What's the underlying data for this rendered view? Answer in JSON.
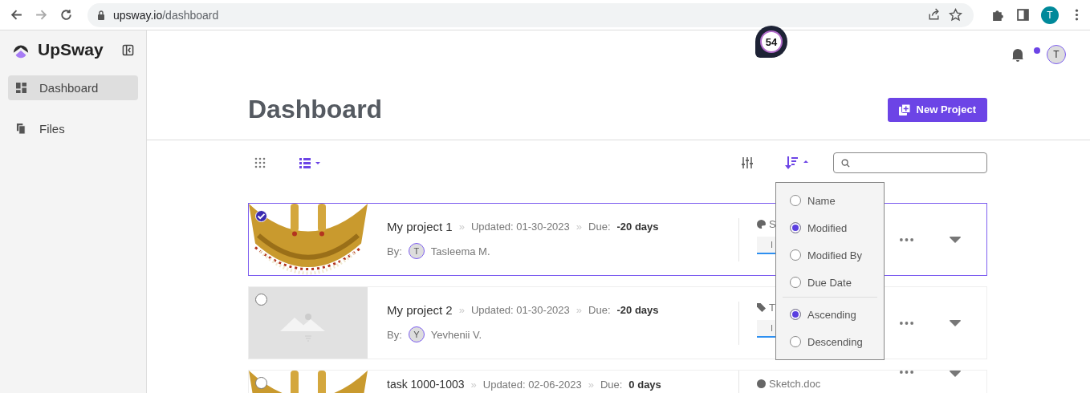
{
  "browser": {
    "url_host": "upsway.io",
    "url_path": "/dashboard",
    "profile": "T"
  },
  "sidebar": {
    "logo": "UpSway",
    "items": [
      {
        "label": "Dashboard",
        "kind": "dashboard",
        "selected": true
      },
      {
        "label": "Files",
        "kind": "files",
        "selected": false
      }
    ]
  },
  "header": {
    "score": "54",
    "notification": true,
    "avatar": "T"
  },
  "page": {
    "title": "Dashboard",
    "new_button": "New Project"
  },
  "view_options": [
    {
      "kind": "grid",
      "selected": false
    },
    {
      "kind": "list",
      "selected": true
    }
  ],
  "sort_menu": {
    "fields": [
      {
        "label": "Name",
        "selected": false
      },
      {
        "label": "Modified",
        "selected": true
      },
      {
        "label": "Modified By",
        "selected": false
      },
      {
        "label": "Due Date",
        "selected": false
      }
    ],
    "orders": [
      {
        "label": "Ascending",
        "selected": true
      },
      {
        "label": "Descending",
        "selected": false
      }
    ]
  },
  "projects": [
    {
      "selected": true,
      "name": "My project 1",
      "separators": [
        "»",
        "»"
      ],
      "updated": "Updated: 01-30-2023",
      "due_label": "Due:",
      "due": "-20 days",
      "by_label": "By:",
      "initial": "T",
      "author": "Tasleema M.",
      "category": {
        "kind": "palette",
        "label": "S"
      },
      "side_tab": "I"
    },
    {
      "kind": "placeholder",
      "selected": false,
      "name": "My project 2",
      "separators": [
        "»",
        "»"
      ],
      "updated": "Updated: 01-30-2023",
      "due_label": "Due:",
      "due": "-20 days",
      "by_label": "By:",
      "initial": "Y",
      "author": "Yevhenii V.",
      "category": {
        "kind": "tag",
        "label": "T"
      },
      "side_tab": "I"
    },
    {
      "selected": false,
      "name": "task 1000-1003",
      "separators": [
        "»",
        "»"
      ],
      "updated": "Updated: 02-06-2023",
      "due_label": "Due:",
      "due": "0 days",
      "category": {
        "kind": "globe",
        "label": "Sketch.doc"
      }
    }
  ]
}
